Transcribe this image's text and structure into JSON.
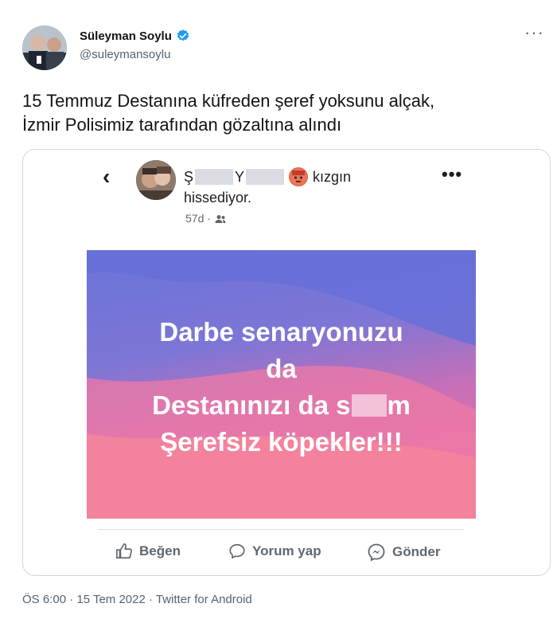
{
  "author": {
    "name": "Süleyman Soylu",
    "handle": "@suleymansoylu",
    "verified_color": "#1d9bf0"
  },
  "icons": {
    "more": "more-horizontal-icon",
    "verified": "verified-badge-icon",
    "back": "chevron-left-icon",
    "friends": "friends-audience-icon",
    "like": "thumbs-up-icon",
    "comment": "comment-bubble-icon",
    "share": "messenger-icon"
  },
  "tweet": {
    "text": "15 Temmuz Destanına küfreden şeref yoksunu alçak,\nİzmir Polisimiz tarafından gözaltına alındı"
  },
  "fb_post": {
    "back_glyph": "‹",
    "name_first_initial": "Ş",
    "name_second_initial": "Y",
    "feeling_word": "kızgın",
    "feeling_rest": "hissediyor.",
    "time": "57d ·",
    "more_glyph": "•••",
    "image_text": {
      "line1": "Darbe senaryonuzu",
      "line2": "da",
      "line3_prefix": "Destanınızı da s",
      "line3_suffix": "m",
      "line4": "Şerefsiz köpekler!!!"
    },
    "actions": {
      "like": "Beğen",
      "comment": "Yorum yap",
      "share": "Gönder"
    },
    "colors": {
      "text": "#1c1e21",
      "secondary": "#65676b"
    }
  },
  "footer": {
    "meta": "ÖS 6:00 · 15 Tem 2022 · Twitter for Android"
  }
}
